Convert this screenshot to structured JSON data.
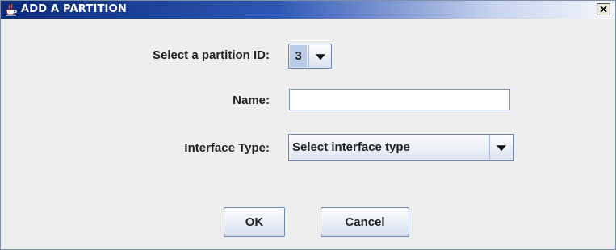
{
  "dialog": {
    "title": "ADD A PARTITION",
    "close_glyph": "✕"
  },
  "form": {
    "partition_id_label": "Select a partition ID:",
    "partition_id_value": "3",
    "name_label": "Name:",
    "name_value": "",
    "interface_type_label": "Interface Type:",
    "interface_type_value": "Select interface type"
  },
  "buttons": {
    "ok": "OK",
    "cancel": "Cancel"
  },
  "icons": {
    "title": "java-cup-icon",
    "dropdown": "chevron-down-icon",
    "close": "close-icon"
  },
  "colors": {
    "titlebar": "#0a2a7a",
    "selection": "#b8cbe7",
    "border": "#6f87b5"
  }
}
